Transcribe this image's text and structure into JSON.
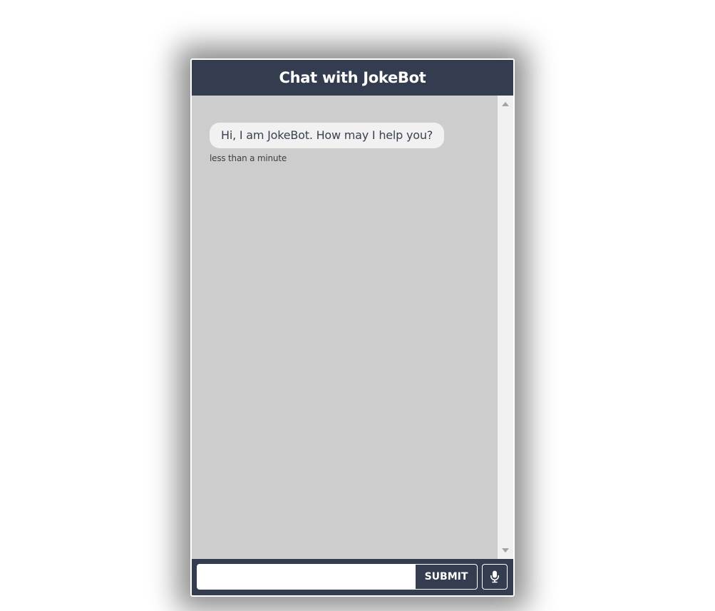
{
  "header": {
    "title": "Chat with JokeBot"
  },
  "messages": [
    {
      "sender": "bot",
      "text": "Hi, I am JokeBot. How may I help you?",
      "time": "less than a minute"
    }
  ],
  "footer": {
    "input_value": "",
    "input_placeholder": "",
    "submit_label": "SUBMIT",
    "mic_icon": "microphone-icon"
  },
  "colors": {
    "header_bg": "#343d4f",
    "body_bg": "#cdcdcd",
    "bubble_bg": "#f1f1f1"
  }
}
